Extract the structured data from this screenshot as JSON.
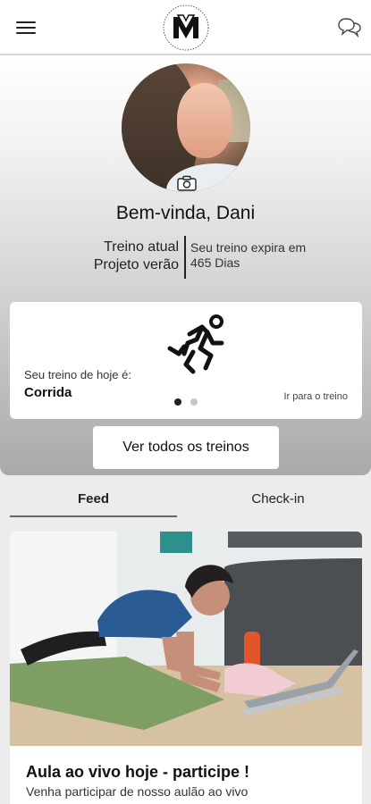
{
  "header": {
    "menu_icon": "hamburger-menu-icon",
    "logo_icon": "brand-logo-icon",
    "chat_icon": "chat-bubbles-icon"
  },
  "profile": {
    "greeting": "Bem-vinda, Dani",
    "camera_icon": "camera-icon",
    "current_plan_label": "Treino atual",
    "current_plan_name": "Projeto verão",
    "expiry_label": "Seu treino expira em",
    "expiry_value": "465 Dias"
  },
  "today": {
    "label": "Seu treino de hoje é:",
    "value": "Corrida",
    "icon": "runner-icon",
    "goto_label": "Ir para o treino",
    "carousel": {
      "total": 2,
      "active": 1
    }
  },
  "actions": {
    "view_all_label": "Ver todos os treinos"
  },
  "tabs": [
    {
      "label": "Feed",
      "active": true
    },
    {
      "label": "Check-in",
      "active": false
    }
  ],
  "feed": {
    "post": {
      "title": "Aula ao vivo hoje - participe !",
      "subtitle": "Venha participar de nosso aulão ao vivo"
    }
  },
  "colors": {
    "accent": "#111111",
    "card": "#ffffff",
    "hero_top": "#ffffff",
    "hero_bottom": "#a9a9a9"
  }
}
